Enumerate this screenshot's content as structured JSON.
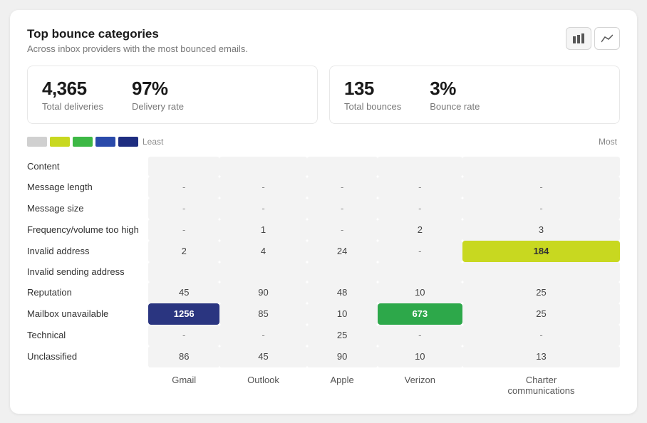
{
  "header": {
    "title": "Top bounce categories",
    "subtitle": "Across inbox providers with the most bounced emails."
  },
  "toggle_buttons": [
    {
      "label": "bar-chart-icon",
      "icon": "▐▌",
      "active": true
    },
    {
      "label": "line-chart-icon",
      "icon": "╱╲",
      "active": false
    }
  ],
  "stats": [
    {
      "left": {
        "value": "4,365",
        "label": "Total deliveries"
      },
      "right": {
        "value": "97%",
        "label": "Delivery rate"
      }
    },
    {
      "left": {
        "value": "135",
        "label": "Total bounces"
      },
      "right": {
        "value": "3%",
        "label": "Bounce rate"
      }
    }
  ],
  "legend": {
    "least_label": "Least",
    "most_label": "Most",
    "colors": [
      "#d0d0d0",
      "#c8d820",
      "#3db845",
      "#2a4aaa",
      "#1e2d80"
    ]
  },
  "columns": [
    "Gmail",
    "Outlook",
    "Apple",
    "Verizon",
    "Charter\ncommunications"
  ],
  "rows": [
    {
      "label": "Content",
      "values": [
        "",
        "",
        "",
        "",
        ""
      ]
    },
    {
      "label": "Message length",
      "values": [
        "-",
        "-",
        "-",
        "-",
        "-"
      ]
    },
    {
      "label": "Message size",
      "values": [
        "-",
        "-",
        "-",
        "-",
        "-"
      ]
    },
    {
      "label": "Frequency/volume too high",
      "values": [
        "-",
        "1",
        "-",
        "2",
        "3"
      ]
    },
    {
      "label": "Invalid address",
      "values": [
        "2",
        "4",
        "24",
        "-",
        "184"
      ]
    },
    {
      "label": "Invalid sending address",
      "values": [
        "",
        "",
        "",
        "",
        ""
      ]
    },
    {
      "label": "Reputation",
      "values": [
        "45",
        "90",
        "48",
        "10",
        "25"
      ]
    },
    {
      "label": "Mailbox unavailable",
      "values": [
        "1256",
        "85",
        "10",
        "673",
        "25"
      ]
    },
    {
      "label": "Technical",
      "values": [
        "-",
        "-",
        "25",
        "-",
        "-"
      ]
    },
    {
      "label": "Unclassified",
      "values": [
        "86",
        "45",
        "90",
        "10",
        "13"
      ]
    }
  ],
  "highlights": {
    "row6_col4": "highlight-yellow",
    "row7_col0": "highlight-blue-dark",
    "row7_col3": "highlight-green"
  }
}
